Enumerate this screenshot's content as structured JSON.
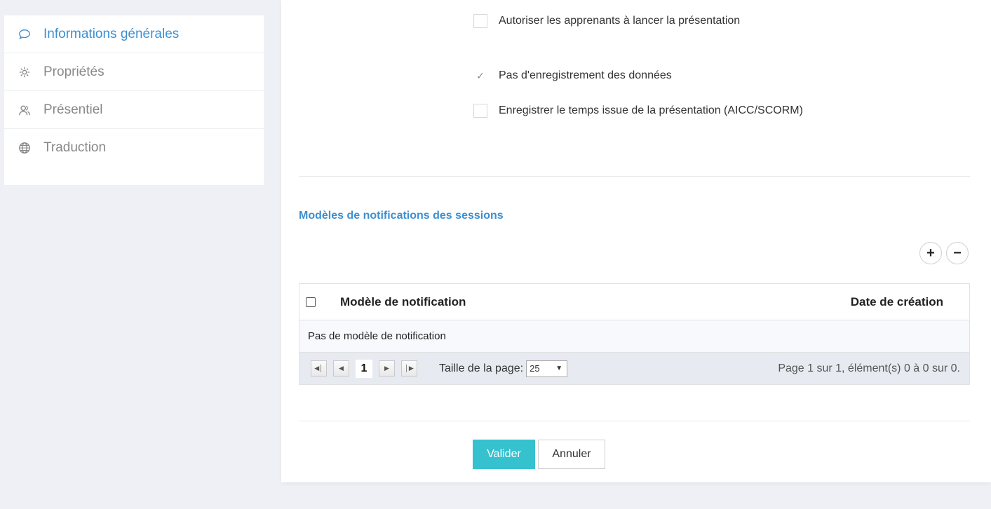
{
  "sidebar": {
    "items": [
      {
        "label": "Informations générales",
        "icon": "chat-bubble-icon",
        "active": true
      },
      {
        "label": "Propriétés",
        "icon": "gear-icon",
        "active": false
      },
      {
        "label": "Présentiel",
        "icon": "users-icon",
        "active": false
      },
      {
        "label": "Traduction",
        "icon": "globe-icon",
        "active": false
      }
    ]
  },
  "options": {
    "allow_launch": {
      "label": "Autoriser les apprenants à lancer la présentation",
      "checked": false
    },
    "no_data_recording": {
      "label": "Pas d'enregistrement des données",
      "checked": true
    },
    "record_time": {
      "label": "Enregistrer le temps issue de la présentation (AICC/SCORM)",
      "checked": false
    }
  },
  "notifications": {
    "title": "Modèles de notifications des sessions",
    "add_symbol": "+",
    "remove_symbol": "−",
    "columns": {
      "template": "Modèle de notification",
      "created": "Date de création"
    },
    "empty_text": "Pas de modèle de notification",
    "pager": {
      "current_page": "1",
      "page_size_label": "Taille de la page:",
      "page_size": "25",
      "info": "Page 1 sur 1, élément(s) 0 à 0 sur 0."
    }
  },
  "actions": {
    "submit": "Valider",
    "cancel": "Annuler"
  },
  "colors": {
    "accent": "#3d8fd1",
    "primary_button": "#36c1cf",
    "background": "#eef0f5"
  }
}
